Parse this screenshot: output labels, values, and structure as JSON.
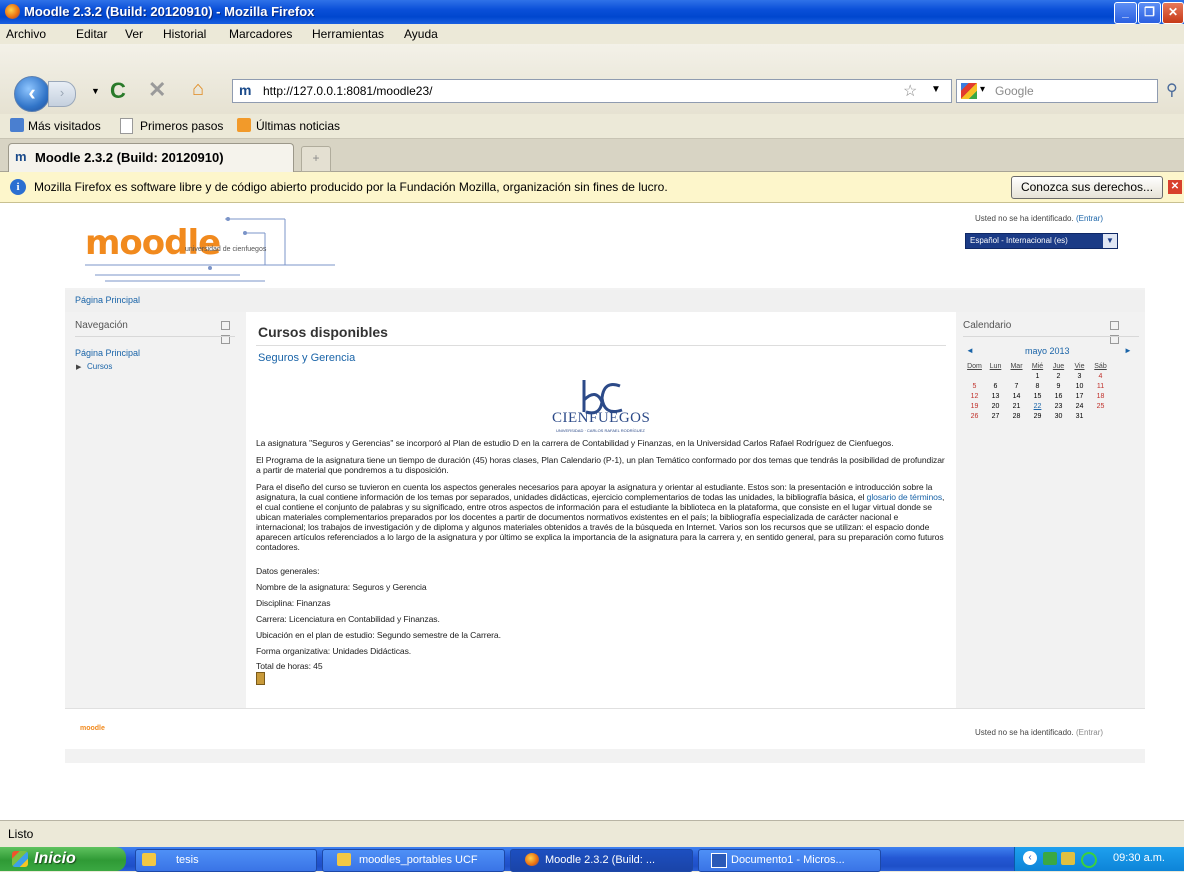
{
  "window": {
    "title": "Moodle 2.3.2 (Build: 20120910) - Mozilla Firefox"
  },
  "menu": [
    "Archivo",
    "Editar",
    "Ver",
    "Historial",
    "Marcadores",
    "Herramientas",
    "Ayuda"
  ],
  "toolbar": {
    "url": "http://127.0.0.1:8081/moodle23/",
    "search_placeholder": "Google"
  },
  "bookmarks": [
    "Más visitados",
    "Primeros pasos",
    "Últimas noticias"
  ],
  "tabs": [
    {
      "label": "Moodle 2.3.2 (Build: 20120910)"
    }
  ],
  "infobar": {
    "message": "Mozilla Firefox es software libre y de código abierto producido por la Fundación Mozilla, organización sin fines de lucro.",
    "button": "Conozca sus derechos..."
  },
  "page": {
    "login_text": "Usted no se ha identificado.",
    "login_link": "(Entrar)",
    "language": "Español - Internacional (es)",
    "logo_text": "moodle",
    "logo_sub": "universidad de cienfuegos",
    "breadcrumb": "Página Principal",
    "nav_block": {
      "title": "Navegación",
      "home": "Página Principal",
      "courses": "Cursos"
    },
    "center": {
      "heading": "Cursos disponibles",
      "course_link": "Seguros y Gerencia",
      "uni_logo_text": "CIENFUEGOS",
      "uni_logo_sub": "UNIVERSIDAD · CARLOS RAFAEL RODRÍGUEZ",
      "p1": "La asignatura \"Seguros y Gerencias\" se incorporó al Plan de estudio D en la carrera de Contabilidad y Finanzas, en la Universidad Carlos Rafael Rodríguez de Cienfuegos.",
      "p2": "El Programa de la asignatura tiene un tiempo de duración (45) horas clases, Plan Calendario (P-1), un plan Temático conformado por dos temas que tendrás la posibilidad de profundizar a partir de material que pondremos a tu disposición.",
      "p3a": "Para el diseño del curso se tuvieron en cuenta los aspectos generales necesarios para apoyar la asignatura y orientar al estudiante. Estos son: la presentación e introducción sobre la asignatura, la cual contiene información de los temas por separados, unidades didácticas, ejercicio complementarios de todas las unidades, la bibliografía básica, el",
      "p3link": "glosario de términos",
      "p3b": ", el cual contiene el conjunto de palabras y su significado, entre otros aspectos de información para el estudiante la biblioteca en la plataforma, que consiste en el lugar virtual donde se ubican materiales complementarios preparados por los docentes a partir de documentos normativos existentes en el país; la bibliografía especializada de carácter nacional e internacional; los trabajos de investigación y de diploma y algunos materiales obtenidos a través de la búsqueda en Internet. Varios son los recursos que se utilizan: el espacio donde aparecen artículos referenciados a lo largo de la asignatura y por último se explica la importancia de la asignatura para la carrera y, en sentido general, para su preparación como futuros contadores.",
      "datos": "Datos generales:",
      "nombre": "Nombre de la asignatura: Seguros y Gerencia",
      "disciplina": "Disciplina: Finanzas",
      "carrera": "Carrera: Licenciatura en Contabilidad y Finanzas.",
      "ubicacion": "Ubicación en el plan de estudio: Segundo semestre de la Carrera.",
      "forma": "Forma organizativa: Unidades Didácticas.",
      "total": "Total de horas: 45"
    },
    "calendar": {
      "title": "Calendario",
      "month": "mayo 2013",
      "prev": "◄",
      "next": "►",
      "days": [
        "Dom",
        "Lun",
        "Mar",
        "Mié",
        "Jue",
        "Vie",
        "Sáb"
      ],
      "weeks": [
        [
          "",
          "",
          "",
          "1",
          "2",
          "3",
          "4"
        ],
        [
          "5",
          "6",
          "7",
          "8",
          "9",
          "10",
          "11"
        ],
        [
          "12",
          "13",
          "14",
          "15",
          "16",
          "17",
          "18"
        ],
        [
          "19",
          "20",
          "21",
          "22",
          "23",
          "24",
          "25"
        ],
        [
          "26",
          "27",
          "28",
          "29",
          "30",
          "31",
          ""
        ]
      ]
    },
    "footer_logo": "moodle"
  },
  "status": "Listo",
  "taskbar": {
    "start": "Inicio",
    "items": [
      "tesis",
      "moodles_portables UCF",
      "Moodle 2.3.2 (Build: ...",
      "Documento1 - Micros..."
    ],
    "clock": "09:30 a.m."
  },
  "colors": {
    "link": "#1a64a8",
    "xp_blue": "#0047cf",
    "weekend": "#c0302a",
    "today": "#1a64a8"
  }
}
